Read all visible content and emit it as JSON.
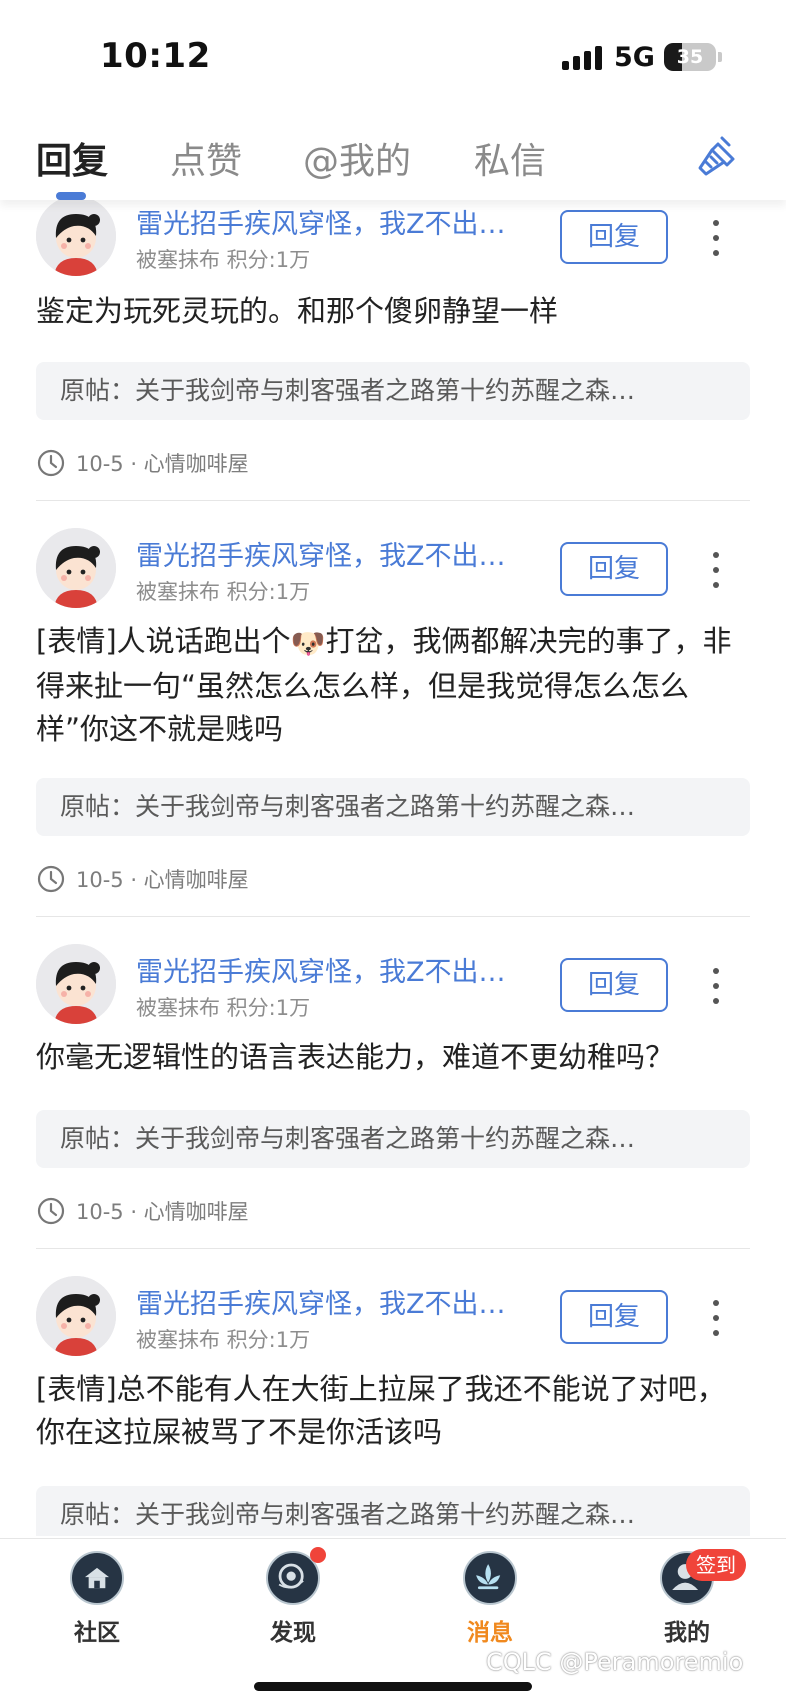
{
  "status": {
    "time": "10:12",
    "network": "5G",
    "battery": "35",
    "battery_level": 0.35
  },
  "tabs": [
    {
      "label": "回复",
      "active": true
    },
    {
      "label": "点赞",
      "active": false
    },
    {
      "label": "@我的",
      "active": false
    },
    {
      "label": "私信",
      "active": false
    }
  ],
  "header": {
    "clean_icon": "broom-icon"
  },
  "replies": [
    {
      "username": "雷光招手疾风穿怪，我Z不出…",
      "user_meta": "被塞抹布  积分:1万",
      "reply_label": "回复",
      "comment": "鉴定为玩死灵玩的。和那个傻卵静望一样",
      "orig_post": "原帖：关于我剑帝与刺客强者之路第十约苏醒之森…",
      "meta": "10-5 · 心情咖啡屋"
    },
    {
      "username": "雷光招手疾风穿怪，我Z不出…",
      "user_meta": "被塞抹布  积分:1万",
      "reply_label": "回复",
      "comment_before": "[表情]人说话跑出个",
      "comment_emoji": "🐶",
      "comment_after": "打岔，我俩都解决完的事了，非得来扯一句“虽然怎么怎么样，但是我觉得怎么怎么样”你这不就是贱吗",
      "orig_post": "原帖：关于我剑帝与刺客强者之路第十约苏醒之森…",
      "meta": "10-5 · 心情咖啡屋"
    },
    {
      "username": "雷光招手疾风穿怪，我Z不出…",
      "user_meta": "被塞抹布  积分:1万",
      "reply_label": "回复",
      "comment": "你毫无逻辑性的语言表达能力，难道不更幼稚吗？",
      "orig_post": "原帖：关于我剑帝与刺客强者之路第十约苏醒之森…",
      "meta": "10-5 · 心情咖啡屋"
    },
    {
      "username": "雷光招手疾风穿怪，我Z不出…",
      "user_meta": "被塞抹布  积分:1万",
      "reply_label": "回复",
      "comment": "[表情]总不能有人在大街上拉屎了我还不能说了对吧，你在这拉屎被骂了不是你活该吗",
      "orig_post": "原帖：关于我剑帝与刺客强者之路第十约苏醒之森…",
      "meta": ""
    }
  ],
  "nav": [
    {
      "label": "社区",
      "icon": "community-icon",
      "active": false
    },
    {
      "label": "发现",
      "icon": "discover-icon",
      "active": false
    },
    {
      "label": "消息",
      "icon": "messages-icon",
      "active": true
    },
    {
      "label": "我的",
      "icon": "profile-icon",
      "active": false
    }
  ],
  "sign_in_badge": "签到",
  "watermark": "CQLC @Peramoremio",
  "colors": {
    "accent_blue": "#4a7bd6",
    "active_orange": "#f0891e",
    "badge_red": "#f0443a"
  }
}
